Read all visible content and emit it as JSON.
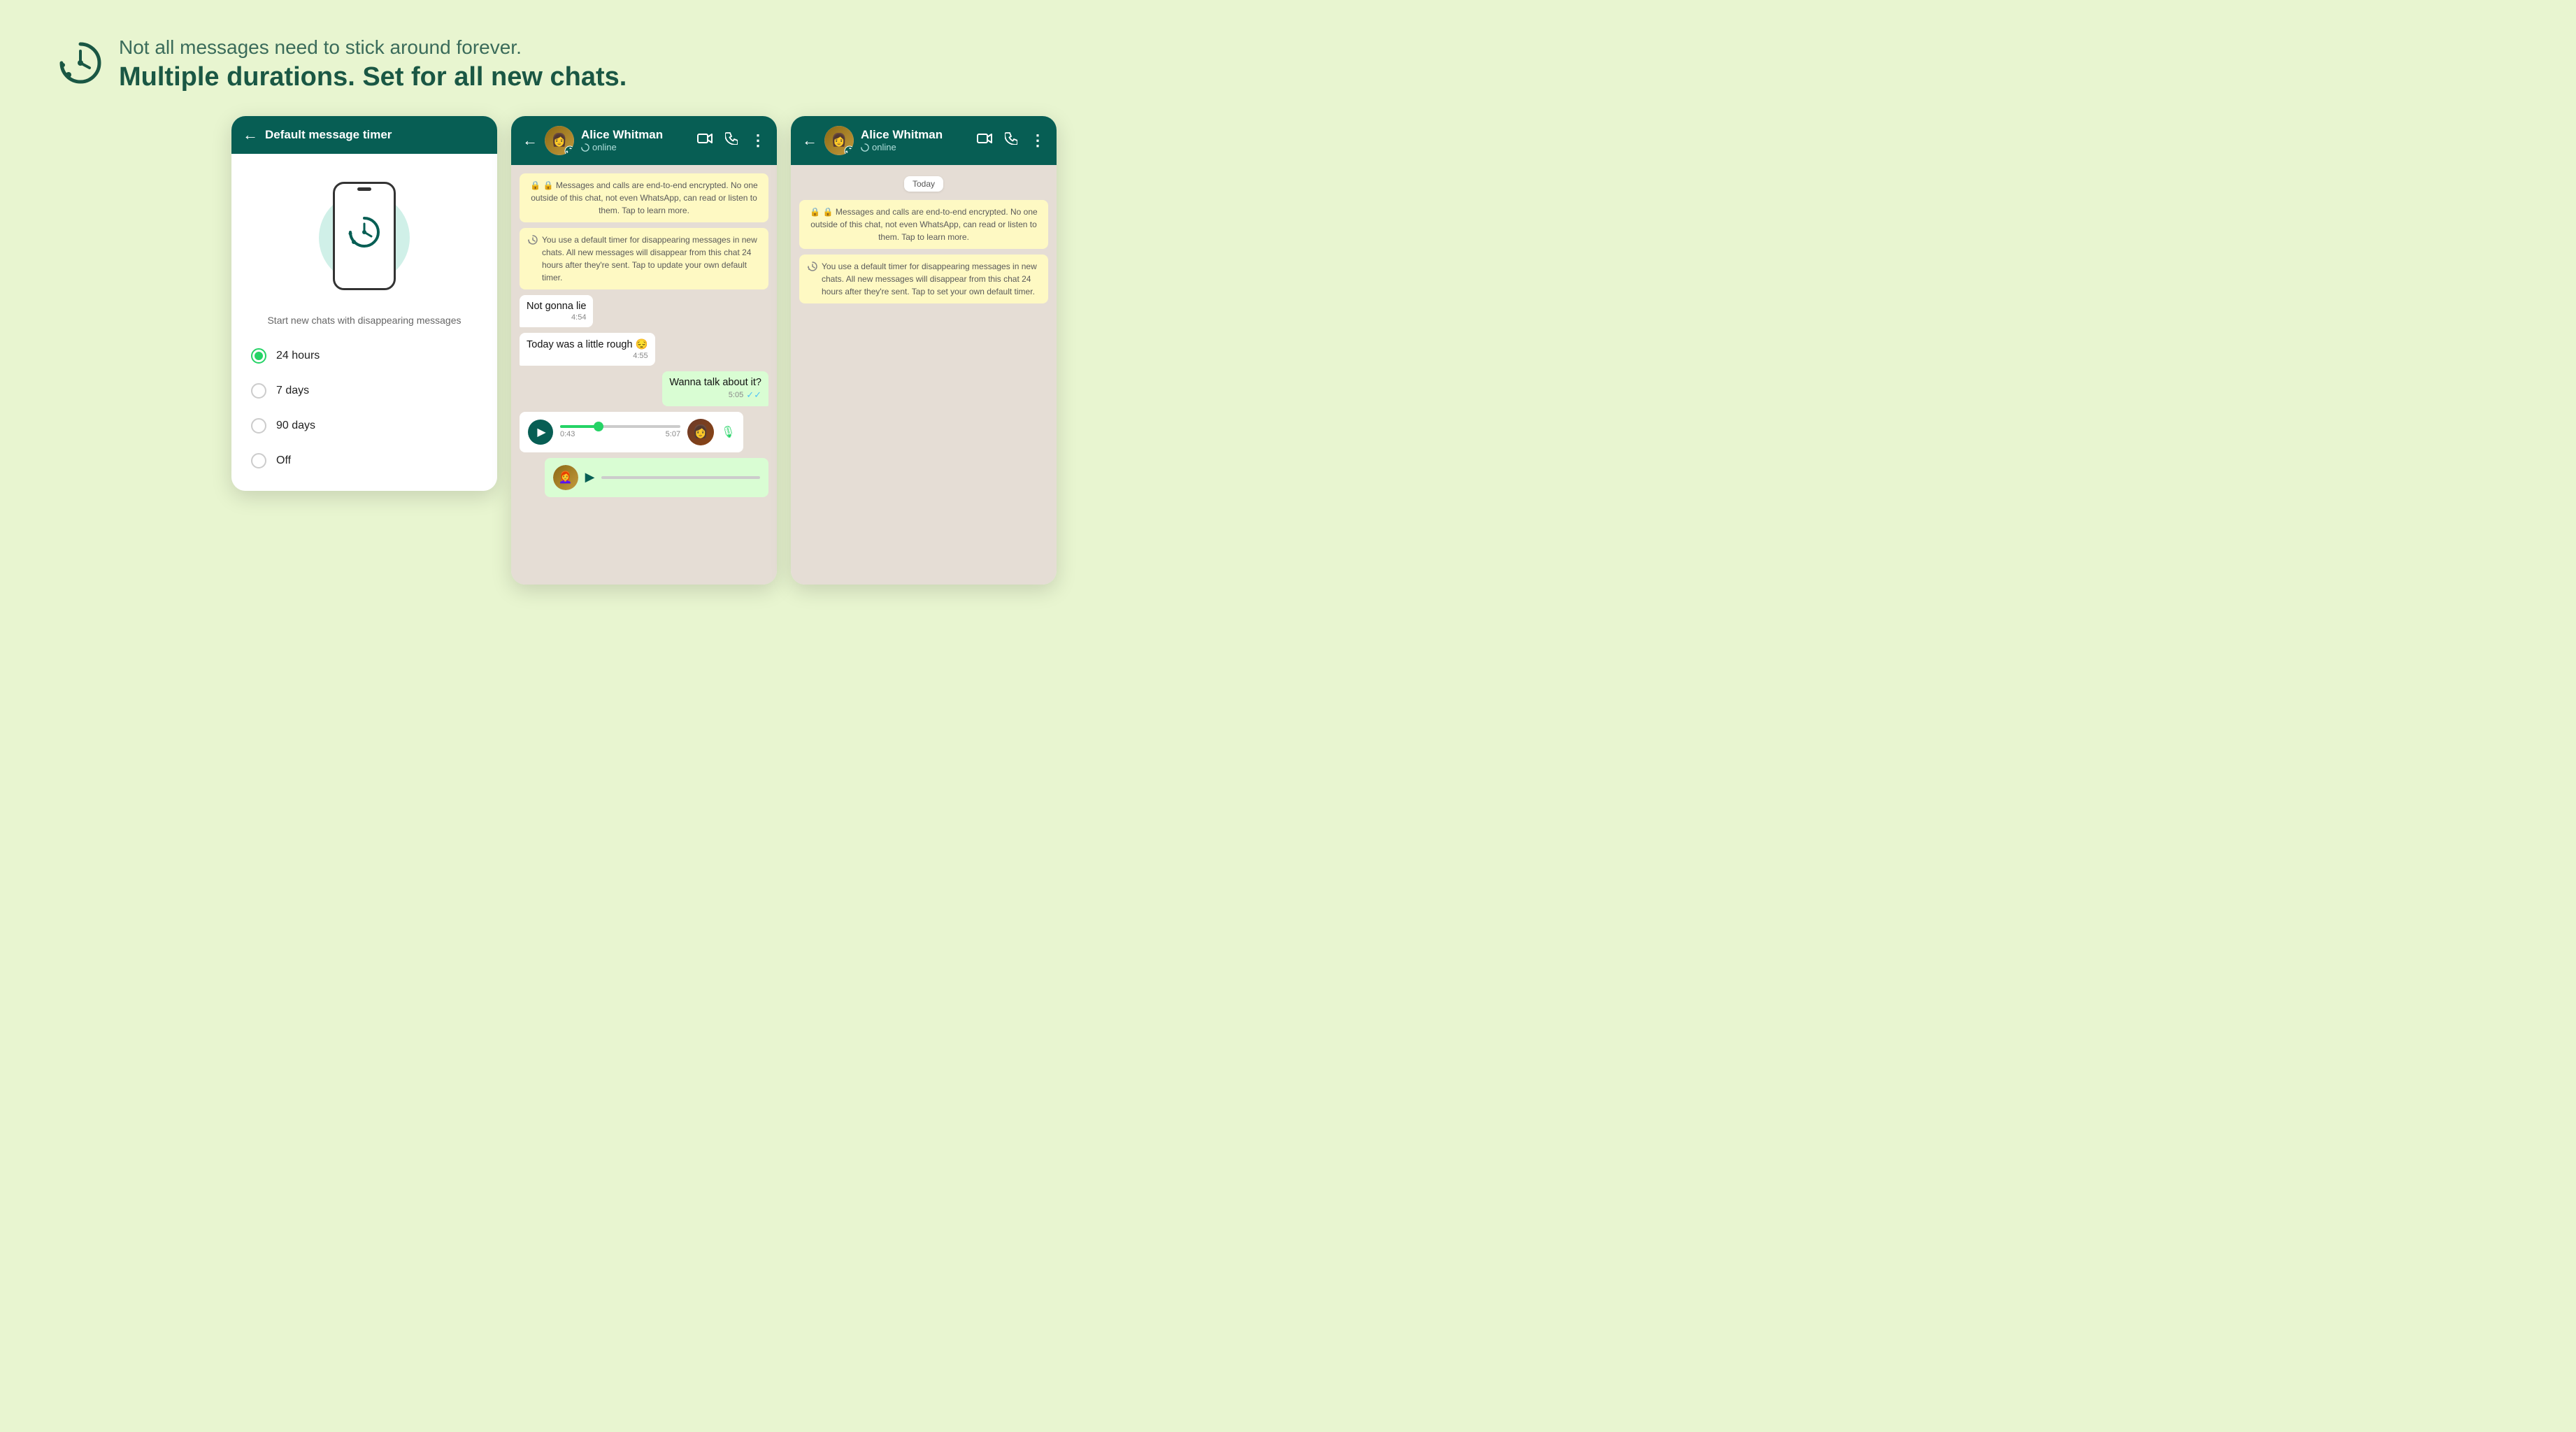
{
  "background_color": "#e8f5d0",
  "header": {
    "subtitle": "Not all messages need to stick around forever.",
    "title": "Multiple durations. Set for all new chats."
  },
  "panel1": {
    "title": "Default message timer",
    "phone_label": "Start new chats with disappearing messages",
    "options": [
      {
        "label": "24 hours",
        "selected": true
      },
      {
        "label": "7 days",
        "selected": false
      },
      {
        "label": "90 days",
        "selected": false
      },
      {
        "label": "Off",
        "selected": false
      }
    ]
  },
  "panel2": {
    "contact_name": "Alice Whitman",
    "status": "online",
    "system_msg1": "🔒 Messages and calls are end-to-end encrypted. No one outside of this chat, not even WhatsApp, can read or listen to them. Tap to learn more.",
    "system_msg2": "You use a default timer for disappearing messages in new chats. All new messages will disappear from this chat 24 hours after they're sent. Tap to update your own default timer.",
    "messages": [
      {
        "text": "Not gonna lie",
        "time": "4:54",
        "type": "received"
      },
      {
        "text": "Today was a little rough 😔",
        "time": "4:55",
        "type": "received"
      },
      {
        "text": "Wanna talk about it?",
        "time": "5:05",
        "type": "sent",
        "ticks": "✓✓"
      }
    ],
    "voice1": {
      "current_time": "0:43",
      "total_time": "5:07"
    },
    "video_icon": "📹",
    "call_icon": "📞",
    "more_icon": "⋮"
  },
  "panel3": {
    "contact_name": "Alice Whitman",
    "status": "online",
    "today_label": "Today",
    "system_msg1": "🔒 Messages and calls are end-to-end encrypted. No one outside of this chat, not even WhatsApp, can read or listen to them. Tap to learn more.",
    "system_msg2": "You use a default timer for disappearing messages in new chats. All new messages will disappear from this chat 24 hours after they're sent. Tap to set your own default timer.",
    "video_icon": "📹",
    "call_icon": "📞",
    "more_icon": "⋮"
  },
  "colors": {
    "whatsapp_green": "#075e54",
    "light_green": "#25d366",
    "sent_bubble": "#d9fdd3",
    "system_yellow": "#fef9c3",
    "chat_bg": "#e5ddd5"
  }
}
